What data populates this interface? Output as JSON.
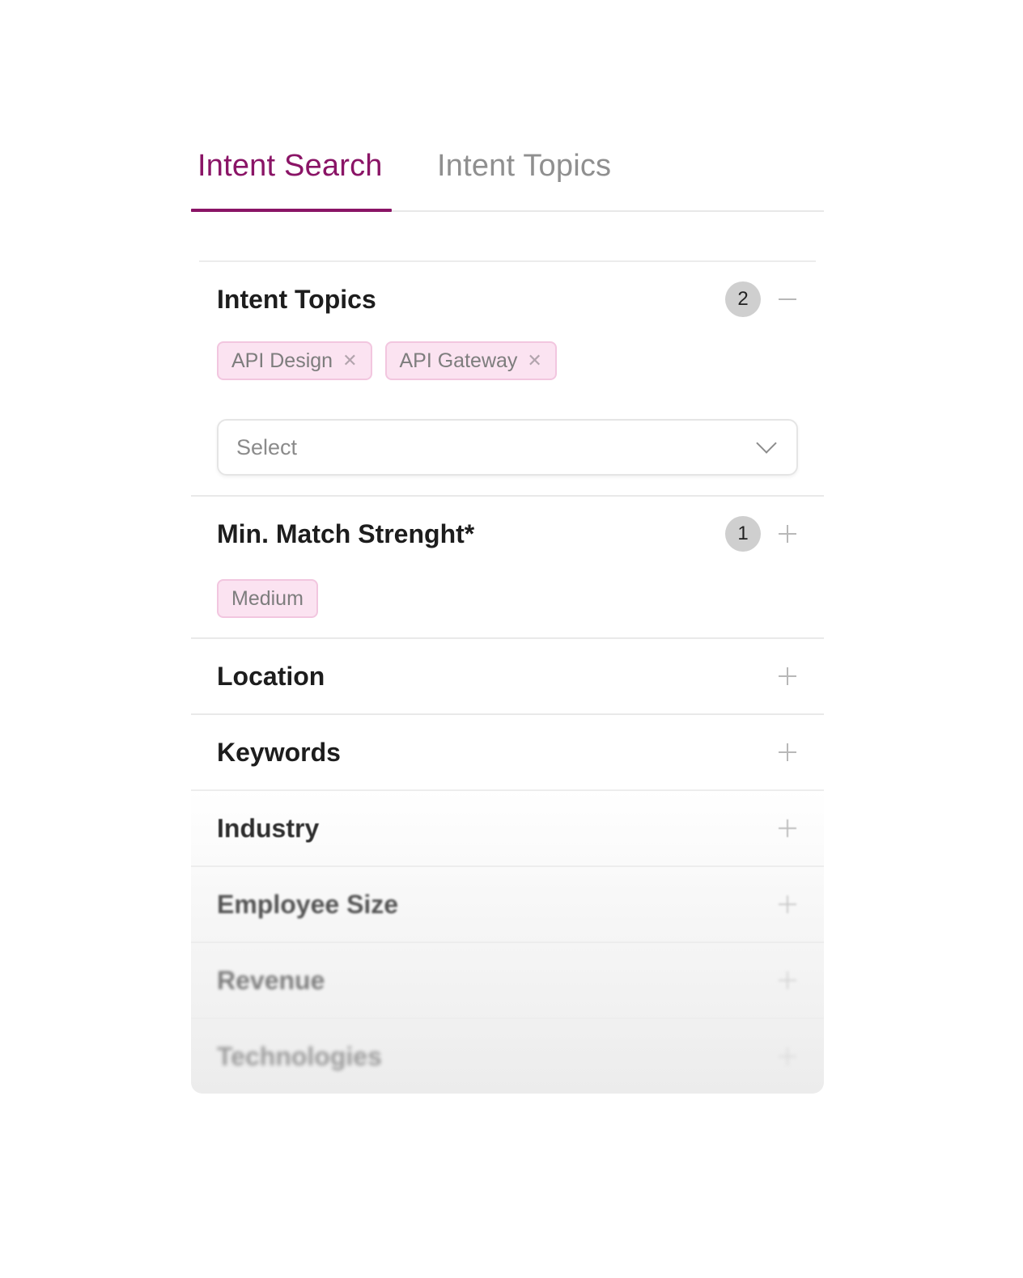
{
  "tabs": [
    {
      "label": "Intent Search",
      "active": true
    },
    {
      "label": "Intent Topics",
      "active": false
    }
  ],
  "sections": {
    "intent_topics": {
      "title": "Intent Topics",
      "count": "2",
      "state": "expanded",
      "chips": [
        "API Design",
        "API Gateway"
      ],
      "select": {
        "placeholder": "Select"
      }
    },
    "match_strength": {
      "title": "Min. Match Strenght*",
      "count": "1",
      "state": "collapsed",
      "chips": [
        "Medium"
      ]
    },
    "location": {
      "title": "Location"
    },
    "keywords": {
      "title": "Keywords"
    },
    "industry": {
      "title": "Industry"
    },
    "employee_size": {
      "title": "Employee Size"
    },
    "revenue": {
      "title": "Revenue"
    },
    "technologies": {
      "title": "Technologies"
    }
  },
  "colors": {
    "accent": "#8a1466",
    "chip_bg": "#fbe3f1",
    "chip_border": "#f2c6df",
    "badge_bg": "#cfcfcf"
  },
  "icons": {
    "chip_remove": "close-icon",
    "collapse": "minus-icon",
    "expand": "plus-icon",
    "dropdown": "chevron-down-icon"
  }
}
